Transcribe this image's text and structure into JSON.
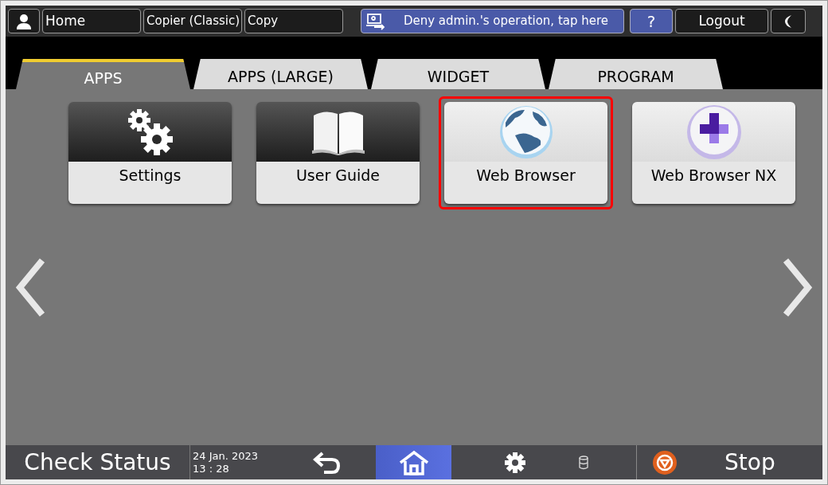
{
  "top_bar": {
    "home_label": "Home",
    "breadcrumbs": [
      "Copier (Classic)",
      "Copy"
    ],
    "notice": "Deny admin.'s operation, tap here",
    "help": "?",
    "logout": "Logout"
  },
  "tabs": [
    {
      "label": "APPS",
      "selected": true
    },
    {
      "label": "APPS (LARGE)",
      "selected": false
    },
    {
      "label": "WIDGET",
      "selected": false
    },
    {
      "label": "PROGRAM",
      "selected": false
    }
  ],
  "apps": [
    {
      "kind": "settings",
      "label": "Settings",
      "highlighted": false
    },
    {
      "kind": "guide",
      "label": "User Guide",
      "highlighted": false
    },
    {
      "kind": "globe",
      "label": "Web Browser",
      "highlighted": true
    },
    {
      "kind": "nx",
      "label": "Web Browser NX",
      "highlighted": false
    }
  ],
  "bottom_bar": {
    "check_status": "Check Status",
    "date": "24 Jan. 2023",
    "time": "13 : 28",
    "stop": "Stop"
  }
}
